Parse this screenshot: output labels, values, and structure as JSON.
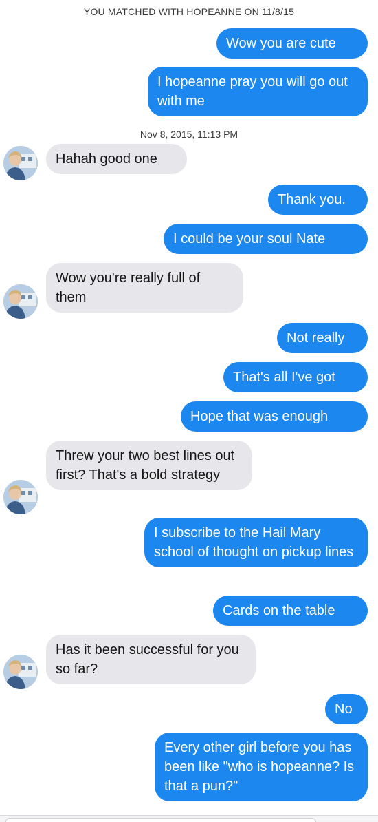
{
  "header": {
    "match_text": "YOU MATCHED WITH HOPEANNE ON 11/8/15"
  },
  "conversation": {
    "timestamp": "Nov 8, 2015, 11:13 PM",
    "messages": [
      {
        "sender": "me",
        "text": "Wow you are cute"
      },
      {
        "sender": "me",
        "text": "I hopeanne pray you will go out with me"
      },
      {
        "sender": "match",
        "text": "Hahah good one"
      },
      {
        "sender": "me",
        "text": "Thank you."
      },
      {
        "sender": "me",
        "text": "I could be your soul Nate"
      },
      {
        "sender": "match",
        "text": "Wow you're really full of them"
      },
      {
        "sender": "me",
        "text": "Not really"
      },
      {
        "sender": "me",
        "text": "That's all I've got"
      },
      {
        "sender": "me",
        "text": "Hope that was enough"
      },
      {
        "sender": "match",
        "text": "Threw your two best lines out first? That's a bold strategy"
      },
      {
        "sender": "me",
        "text": "I subscribe to the Hail Mary school of thought on pickup lines"
      },
      {
        "sender": "me",
        "text": "Cards on the table"
      },
      {
        "sender": "match",
        "text": "Has it been successful for you so far?"
      },
      {
        "sender": "me",
        "text": "No"
      },
      {
        "sender": "me",
        "text": "Every other girl before you has been like \"who is hopeanne? Is that a pun?\""
      }
    ]
  },
  "colors": {
    "outgoing_bubble": "#1b87ef",
    "incoming_bubble": "#e6e6eb"
  },
  "icons": {
    "avatar": "profile-photo-avatar"
  }
}
